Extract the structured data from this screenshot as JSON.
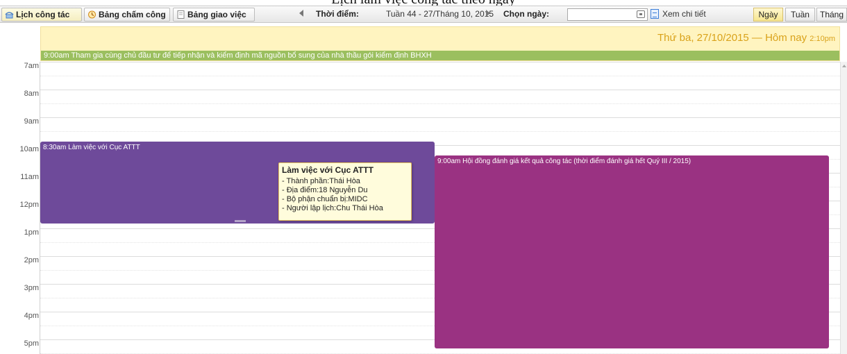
{
  "caption": "Lịch làm việc công tác theo ngày",
  "toolbar": {
    "tabs": [
      {
        "label": "Lịch công tác"
      },
      {
        "label": "Bảng chấm công"
      },
      {
        "label": "Bảng giao việc"
      }
    ],
    "period_label": "Thời điểm:",
    "period_value": "Tuần 44 - 27/Tháng 10, 2015",
    "date_label": "Chọn ngày:",
    "date_value": "",
    "detail_label": "Xem chi tiết",
    "views": [
      {
        "label": "Ngày",
        "active": true
      },
      {
        "label": "Tuần"
      },
      {
        "label": "Tháng"
      }
    ]
  },
  "calendar": {
    "day_title": "Thứ ba, 27/10/2015 — Hôm nay",
    "current_time": "2:10pm",
    "allday_event": "9:00am Tham gia cùng chủ đầu tư để tiếp nhận và kiểm định mã nguồn bổ sung của nhà thầu gói kiểm định BHXH",
    "hours": [
      "7am",
      "8am",
      "9am",
      "10am",
      "11am",
      "12pm",
      "1pm",
      "2pm",
      "3pm",
      "4pm",
      "5pm"
    ],
    "events": [
      {
        "title": "8:30am Làm việc với Cục ATTT",
        "color": "#6e4a9a"
      },
      {
        "title": "9:00am Hội đồng đánh giá kết quả công tác (thời điểm đánh giá hết Quý III / 2015)",
        "color": "#9a3282"
      }
    ],
    "tooltip": {
      "title": "Làm việc với Cục ATTT",
      "lines": [
        "- Thành phần:Thái Hòa",
        "- Địa điểm:18 Nguyễn Du",
        "- Bộ phận chuẩn bị:MIDC",
        "- Người lập lịch:Chu Thái Hòa"
      ]
    }
  },
  "colors": {
    "allday_bg": "#fff4c0",
    "allday_event": "#9bbf5f",
    "day_title": "#d9a21a"
  }
}
